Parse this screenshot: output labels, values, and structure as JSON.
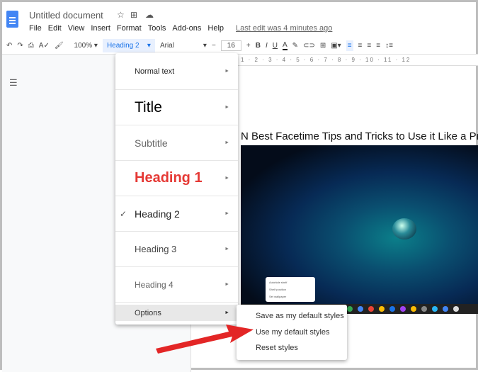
{
  "app": {
    "title": "Untitled document",
    "menus": [
      "File",
      "Edit",
      "View",
      "Insert",
      "Format",
      "Tools",
      "Add-ons",
      "Help"
    ],
    "last_edit": "Last edit was 4 minutes ago"
  },
  "toolbar": {
    "zoom": "100%",
    "style": "Heading 2",
    "font": "Arial",
    "font_size": "16"
  },
  "ruler": "1 · 2 · 3 · 4 · 5 · 6 · 7 · 8 · 9 · 10 · 11 · 12",
  "styles_menu": {
    "items": [
      "Normal text",
      "Title",
      "Subtitle",
      "Heading 1",
      "Heading 2",
      "Heading 3",
      "Heading 4",
      "Options"
    ],
    "checked": "Heading 2"
  },
  "options_submenu": [
    "Save as my default styles",
    "Use my default styles",
    "Reset styles"
  ],
  "document": {
    "heading": "N Best Facetime Tips and Tricks to Use it Like a Pro",
    "image_context_menu": [
      "Autohide shelf",
      "Shelf position",
      "Set wallpaper"
    ]
  },
  "colors": {
    "accent": "#1a73e8",
    "heading1": "#e53935",
    "arrow": "#e32626"
  }
}
